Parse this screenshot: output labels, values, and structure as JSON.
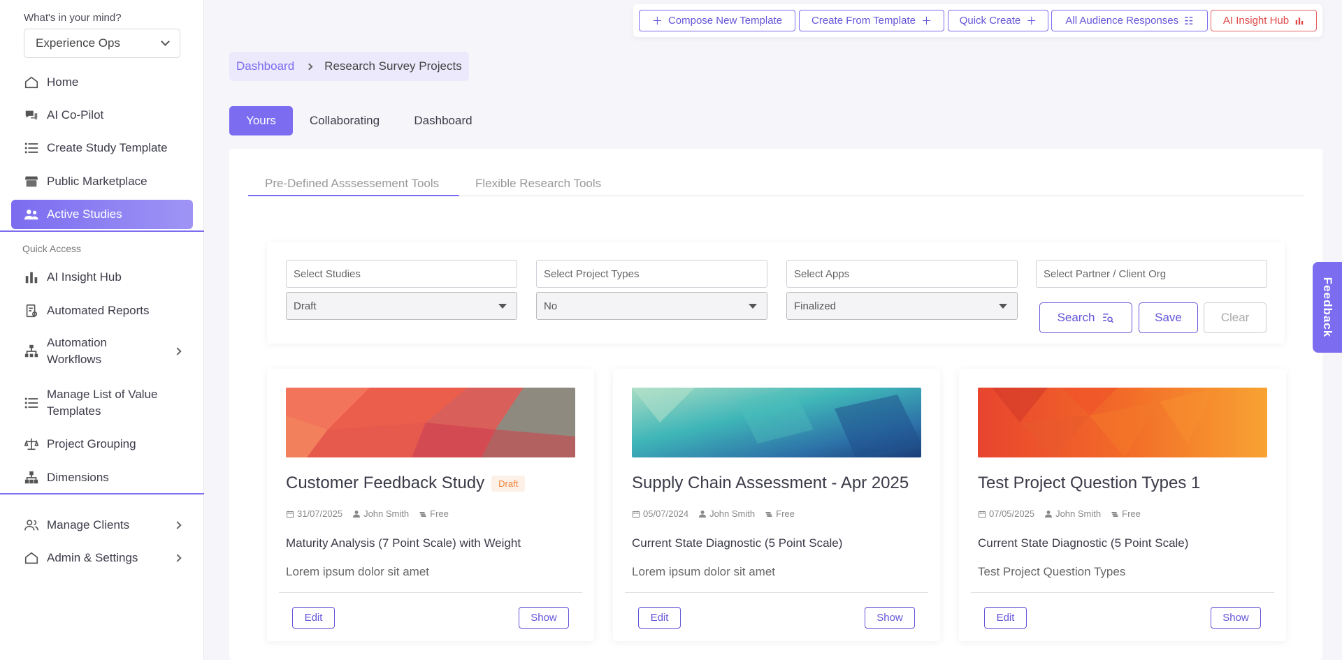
{
  "sidebar": {
    "mind_label": "What's in your mind?",
    "workspace": "Experience Ops",
    "items": [
      {
        "label": "Home"
      },
      {
        "label": "AI Co-Pilot"
      },
      {
        "label": "Create Study Template"
      },
      {
        "label": "Public Marketplace"
      },
      {
        "label": "Active Studies"
      }
    ],
    "quick_access_label": "Quick Access",
    "quick_items": [
      {
        "label": "AI Insight Hub"
      },
      {
        "label": "Automated Reports"
      },
      {
        "label": "Automation Workflows"
      },
      {
        "label": "Manage List of Value Templates"
      },
      {
        "label": "Project Grouping"
      },
      {
        "label": "Dimensions"
      }
    ],
    "bottom_items": [
      {
        "label": "Manage Clients"
      },
      {
        "label": "Admin & Settings"
      }
    ]
  },
  "topbar": {
    "compose": "Compose New Template",
    "from_template": "Create From Template",
    "quick_create": "Quick Create",
    "audience": "All Audience Responses",
    "insight": "AI Insight Hub"
  },
  "breadcrumb": {
    "root": "Dashboard",
    "current": "Research Survey Projects"
  },
  "tabs": [
    "Yours",
    "Collaborating",
    "Dashboard"
  ],
  "subtabs": [
    "Pre-Defined Asssessement Tools",
    "Flexible Research Tools"
  ],
  "filters": {
    "studies_placeholder": "Select Studies",
    "project_types_placeholder": "Select Project Types",
    "apps_placeholder": "Select Apps",
    "partner_placeholder": "Select Partner / Client Org",
    "status_value": "Draft",
    "type_value": "No",
    "app_value": "Finalized",
    "search": "Search",
    "save": "Save",
    "clear": "Clear"
  },
  "cards": [
    {
      "title": "Customer Feedback Study",
      "badge": "Draft",
      "date": "31/07/2025",
      "author": "John Smith",
      "plan": "Free",
      "subtitle": "Maturity Analysis (7 Point Scale) with Weight",
      "desc": "Lorem ipsum dolor sit amet",
      "edit": "Edit",
      "show": "Show"
    },
    {
      "title": "Supply Chain Assessment - Apr 2025",
      "badge": "",
      "date": "05/07/2024",
      "author": "John Smith",
      "plan": "Free",
      "subtitle": "Current State Diagnostic (5 Point Scale)",
      "desc": "Lorem ipsum dolor sit amet",
      "edit": "Edit",
      "show": "Show"
    },
    {
      "title": "Test Project Question Types 1",
      "badge": "",
      "date": "07/05/2025",
      "author": "John Smith",
      "plan": "Free",
      "subtitle": "Current State Diagnostic (5 Point Scale)",
      "desc": "Test Project Question Types",
      "edit": "Edit",
      "show": "Show"
    }
  ],
  "feedback": "Feedback",
  "colors": {
    "accent": "#7b6cf0",
    "danger": "#e04848",
    "badge": "#f0823c"
  }
}
